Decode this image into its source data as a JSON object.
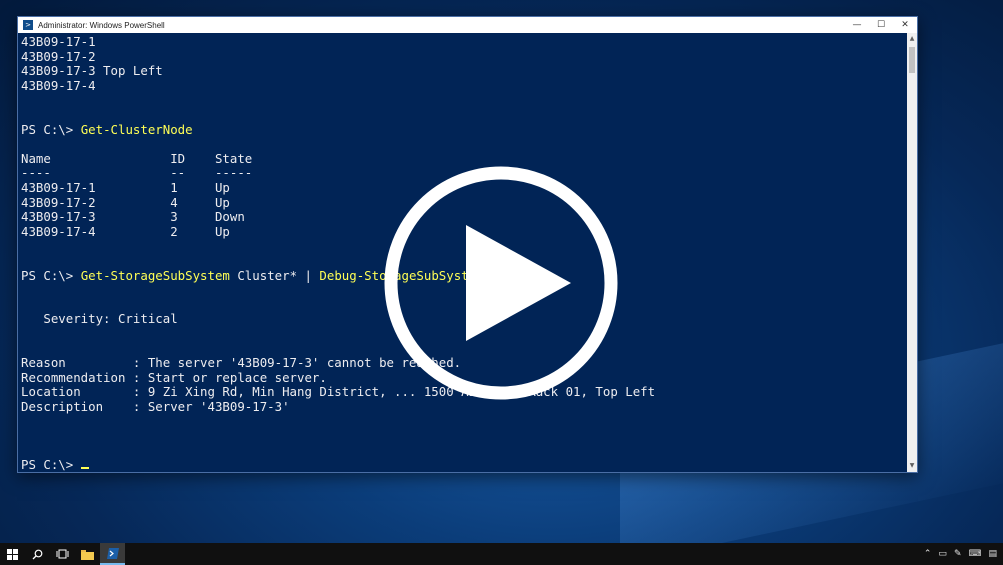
{
  "window": {
    "title": "Administrator: Windows PowerShell",
    "controls": {
      "minimize": "—",
      "maximize": "☐",
      "close": "✕"
    }
  },
  "console": {
    "lines": [
      [
        {
          "t": "43B09-17-1"
        }
      ],
      [
        {
          "t": "43B09-17-2"
        }
      ],
      [
        {
          "t": "43B09-17-3 Top Left"
        }
      ],
      [
        {
          "t": "43B09-17-4"
        }
      ],
      [],
      [],
      [
        {
          "t": "PS C:\\> "
        },
        {
          "t": "Get-ClusterNode",
          "cmd": true
        }
      ],
      [],
      [
        {
          "t": "Name                ID    State"
        }
      ],
      [
        {
          "t": "----                --    -----"
        }
      ],
      [
        {
          "t": "43B09-17-1          1     Up"
        }
      ],
      [
        {
          "t": "43B09-17-2          4     Up"
        }
      ],
      [
        {
          "t": "43B09-17-3          3     Down"
        }
      ],
      [
        {
          "t": "43B09-17-4          2     Up"
        }
      ],
      [],
      [],
      [
        {
          "t": "PS C:\\> "
        },
        {
          "t": "Get-StorageSubSystem",
          "cmd": true
        },
        {
          "t": " Cluster* | "
        },
        {
          "t": "Debug-StorageSubSystem",
          "cmd": true
        }
      ],
      [],
      [],
      [
        {
          "t": "   Severity: Critical"
        }
      ],
      [],
      [],
      [
        {
          "t": "Reason         : The server '43B09-17-3' cannot be reached."
        }
      ],
      [
        {
          "t": "Recommendation : Start or replace server."
        }
      ],
      [
        {
          "t": "Location       : 9 Zi Xing Rd, Min Hang District, ... 1500 Aisle B, Rack 01, Top Left"
        }
      ],
      [
        {
          "t": "Description    : Server '43B09-17-3'"
        }
      ],
      [],
      [],
      [],
      [
        {
          "t": "PS C:\\> "
        }
      ]
    ]
  },
  "video": {
    "control": "play"
  },
  "taskbar": {
    "items": [
      "start-icon",
      "search-icon",
      "task-view-icon",
      "file-explorer-icon",
      "powershell-icon"
    ],
    "tray": [
      "chevron-up-icon",
      "network-icon",
      "pen-icon",
      "keyboard-icon",
      "notifications-icon"
    ]
  }
}
